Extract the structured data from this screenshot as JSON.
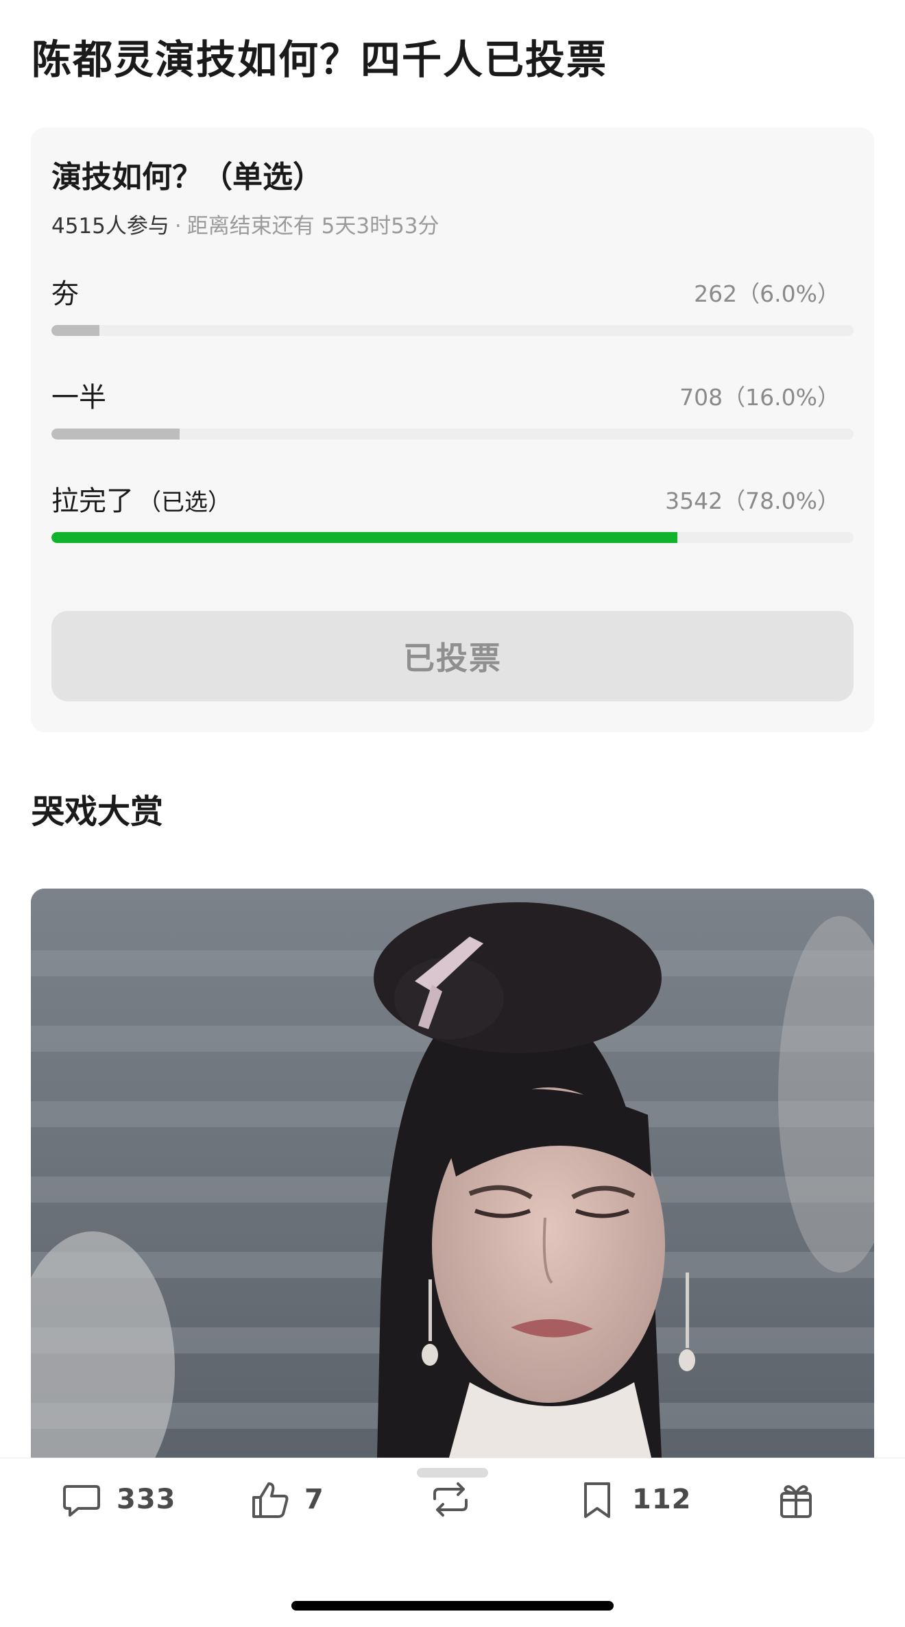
{
  "article": {
    "title": "陈都灵演技如何？四千人已投票"
  },
  "poll": {
    "title": "演技如何？（单选）",
    "participants": "4515人参与",
    "separator": "·",
    "deadline": "距离结束还有 5天3时53分",
    "options": [
      {
        "label": "夯",
        "picked_note": "",
        "count_text": "262（6.0%）",
        "votes": 262,
        "percent": 6.0,
        "selected": false
      },
      {
        "label": "一半",
        "picked_note": "",
        "count_text": "708（16.0%）",
        "votes": 708,
        "percent": 16.0,
        "selected": false
      },
      {
        "label": "拉完了",
        "picked_note": "（已选）",
        "count_text": "3542（78.0%）",
        "votes": 3542,
        "percent": 78.0,
        "selected": true
      }
    ],
    "voted_button_label": "已投票"
  },
  "section": {
    "heading": "哭戏大赏"
  },
  "actions": {
    "comment": {
      "icon": "comment-icon",
      "count": "333"
    },
    "like": {
      "icon": "thumbs-up-icon",
      "count": "7"
    },
    "repost": {
      "icon": "repost-icon",
      "count": ""
    },
    "bookmark": {
      "icon": "bookmark-icon",
      "count": "112"
    },
    "gift": {
      "icon": "gift-icon",
      "count": ""
    }
  },
  "colors": {
    "selected_bar": "#10b32b",
    "unselected_bar": "#bdbdbd",
    "track": "#eeeeee",
    "card_bg": "#f7f7f7",
    "button_bg": "#e3e3e3"
  }
}
